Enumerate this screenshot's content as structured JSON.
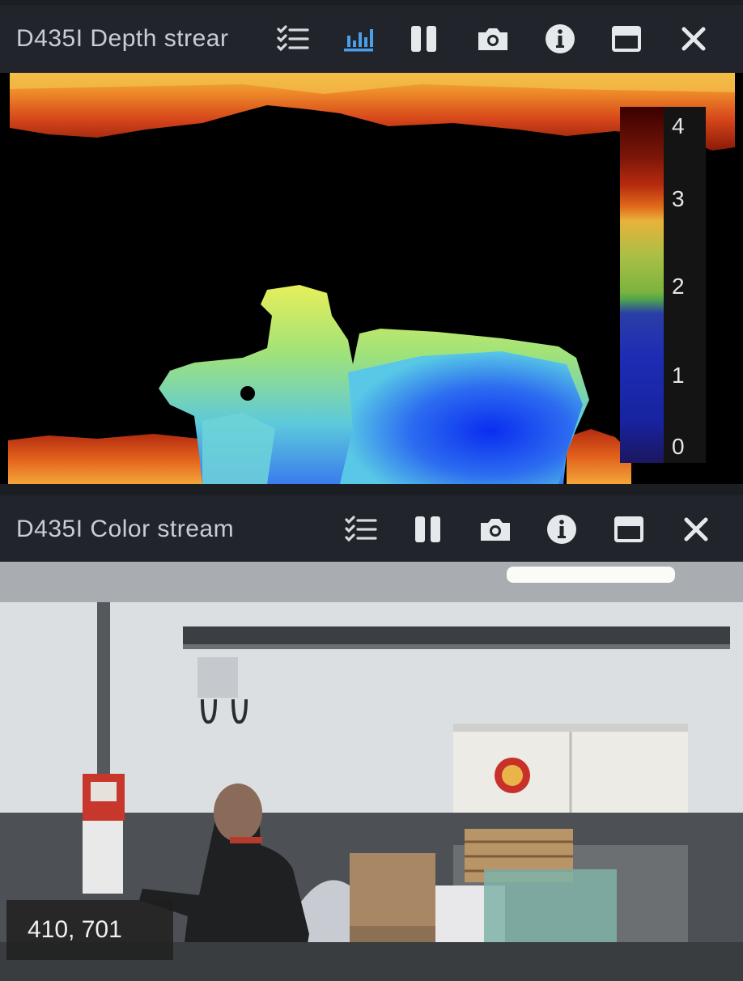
{
  "depth_panel": {
    "title": "D435I Depth strear",
    "icons": [
      "checklist-icon",
      "histogram-icon",
      "pause-icon",
      "camera-icon",
      "info-icon",
      "window-icon",
      "close-icon"
    ],
    "accent_color": "#4a9fe8",
    "colorbar": {
      "ticks": [
        "4",
        "3",
        "2",
        "1",
        "0"
      ]
    }
  },
  "color_panel": {
    "title": "D435I Color stream",
    "icons": [
      "checklist-icon",
      "pause-icon",
      "camera-icon",
      "info-icon",
      "window-icon",
      "close-icon"
    ]
  },
  "cursor_readout": "410, 701"
}
